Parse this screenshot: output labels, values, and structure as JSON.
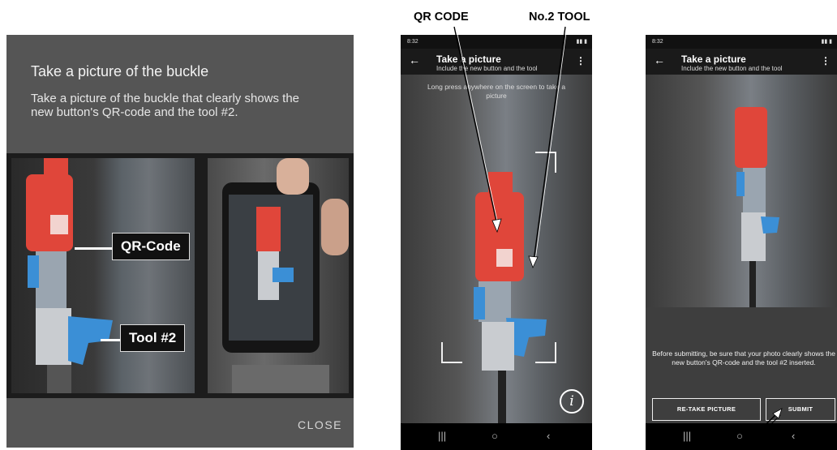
{
  "dialog": {
    "title": "Take a picture of the buckle",
    "body": "Take a picture of the buckle that clearly shows the new button's QR-code and the tool #2.",
    "label_qr": "QR-Code",
    "label_tool": "Tool #2",
    "close_label": "CLOSE"
  },
  "callouts": {
    "qr_code": "QR CODE",
    "tool_2": "No.2 TOOL"
  },
  "phone_capture": {
    "status_time": "8:32",
    "title": "Take a picture",
    "subtitle": "Include the new button and the tool",
    "hint": "Long press anywhere on the screen to take a picture"
  },
  "phone_submit": {
    "status_time": "8:32",
    "title": "Take a picture",
    "subtitle": "Include the new button and the tool",
    "message": "Before submitting, be sure that your photo clearly shows the new button's QR-code and the tool #2 inserted.",
    "retake_label": "RE-TAKE PICTURE",
    "submit_label": "SUBMIT"
  },
  "icons": {
    "back": "arrow-left-icon",
    "menu": "kebab-menu-icon",
    "info": "info-icon",
    "nav_recents": "recents-icon",
    "nav_home": "home-icon",
    "nav_back": "nav-back-icon"
  },
  "colors": {
    "dialog_bg": "#555555",
    "buckle_red": "#e0463a",
    "tool_blue": "#3b8fd6"
  }
}
